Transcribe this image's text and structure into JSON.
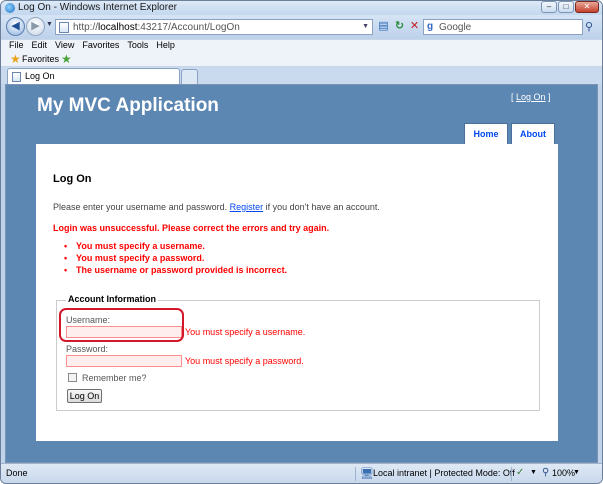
{
  "window": {
    "title": "Log On - Windows Internet Explorer",
    "buttons": {
      "minimize": "–",
      "maximize": "□",
      "close": "✕"
    }
  },
  "address_bar": {
    "prefix": "http://",
    "host": "localhost",
    "path": ":43217/Account/LogOn"
  },
  "search": {
    "logo": "g",
    "placeholder": "Google"
  },
  "menubar": {
    "items": [
      "File",
      "Edit",
      "View",
      "Favorites",
      "Tools",
      "Help"
    ]
  },
  "favorites": {
    "label": "Favorites"
  },
  "tab": {
    "label": "Log On"
  },
  "site": {
    "title": "My MVC Application",
    "login_prefix": "[ ",
    "login_link": "Log On",
    "login_suffix": " ]",
    "menu": [
      "Home",
      "About"
    ]
  },
  "page": {
    "title": "Log On",
    "intro_before": "Please enter your username and password. ",
    "intro_link": "Register",
    "intro_after": " if you don't have an account.",
    "error_summary": "Login was unsuccessful. Please correct the errors and try again.",
    "errors": [
      "You must specify a username.",
      "You must specify a password.",
      "The username or password provided is incorrect."
    ]
  },
  "form": {
    "legend": "Account Information",
    "username_label": "Username:",
    "username_value": "",
    "username_error": "You must specify a username.",
    "password_label": "Password:",
    "password_value": "",
    "password_error": "You must specify a password.",
    "remember_label": "Remember me?",
    "remember_checked": false,
    "submit_label": "Log On"
  },
  "statusbar": {
    "status": "Done",
    "zone": "Local intranet | Protected Mode: Off",
    "zoom": "100%"
  },
  "colors": {
    "page_background": "#5c87b2",
    "error": "#ff0000",
    "link": "#034af3",
    "highlight": "#d4182b"
  }
}
